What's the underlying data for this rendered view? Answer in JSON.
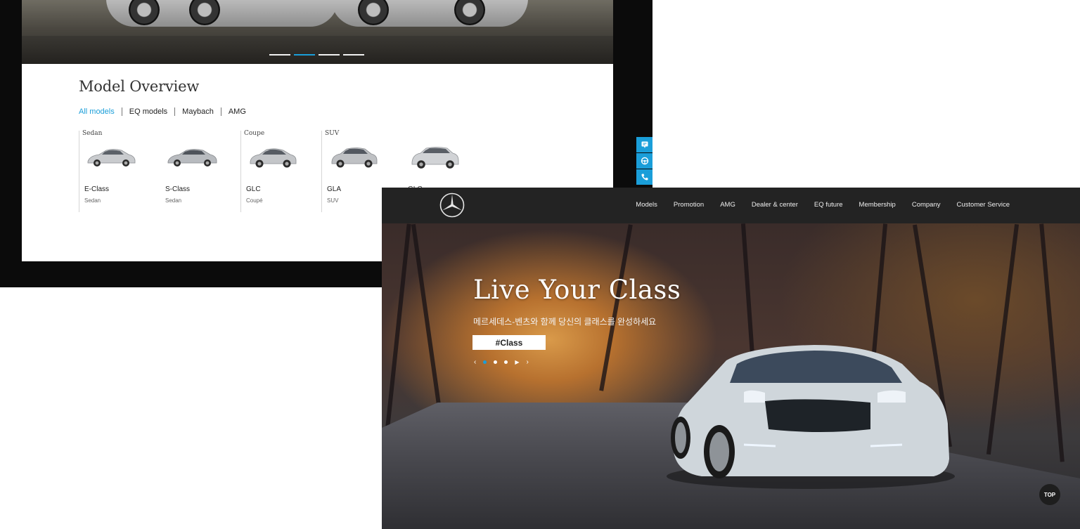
{
  "back_window": {
    "hero_slides": 4,
    "active_slide": 2,
    "title": "Model Overview",
    "tabs": [
      {
        "label": "All models",
        "active": true
      },
      {
        "label": "EQ models",
        "active": false
      },
      {
        "label": "Maybach",
        "active": false
      },
      {
        "label": "AMG",
        "active": false
      }
    ],
    "categories": [
      {
        "label": "Sedan",
        "cars": [
          {
            "name": "E-Class",
            "type": "Sedan"
          },
          {
            "name": "S-Class",
            "type": "Sedan"
          }
        ]
      },
      {
        "label": "Coupe",
        "cars": [
          {
            "name": "GLC",
            "type": "Coupé"
          }
        ]
      },
      {
        "label": "SUV",
        "cars": [
          {
            "name": "GLA",
            "type": "SUV"
          },
          {
            "name": "GLC",
            "type": ""
          }
        ]
      }
    ],
    "side_tools": [
      "chat-icon",
      "steering-wheel-icon",
      "phone-icon"
    ]
  },
  "front_window": {
    "nav": [
      "Models",
      "Promotion",
      "AMG",
      "Dealer & center",
      "EQ future",
      "Membership",
      "Company",
      "Customer Service"
    ],
    "hero": {
      "title": "Live Your Class",
      "subtitle": "메르세데스-벤츠와 함께 당신의 클래스를 완성하세요",
      "tag": "#Class",
      "prev": "‹",
      "play": "▶",
      "next": "›"
    },
    "top_button": "TOP"
  },
  "colors": {
    "accent": "#1a9ed9",
    "nav_bg": "#232323"
  }
}
